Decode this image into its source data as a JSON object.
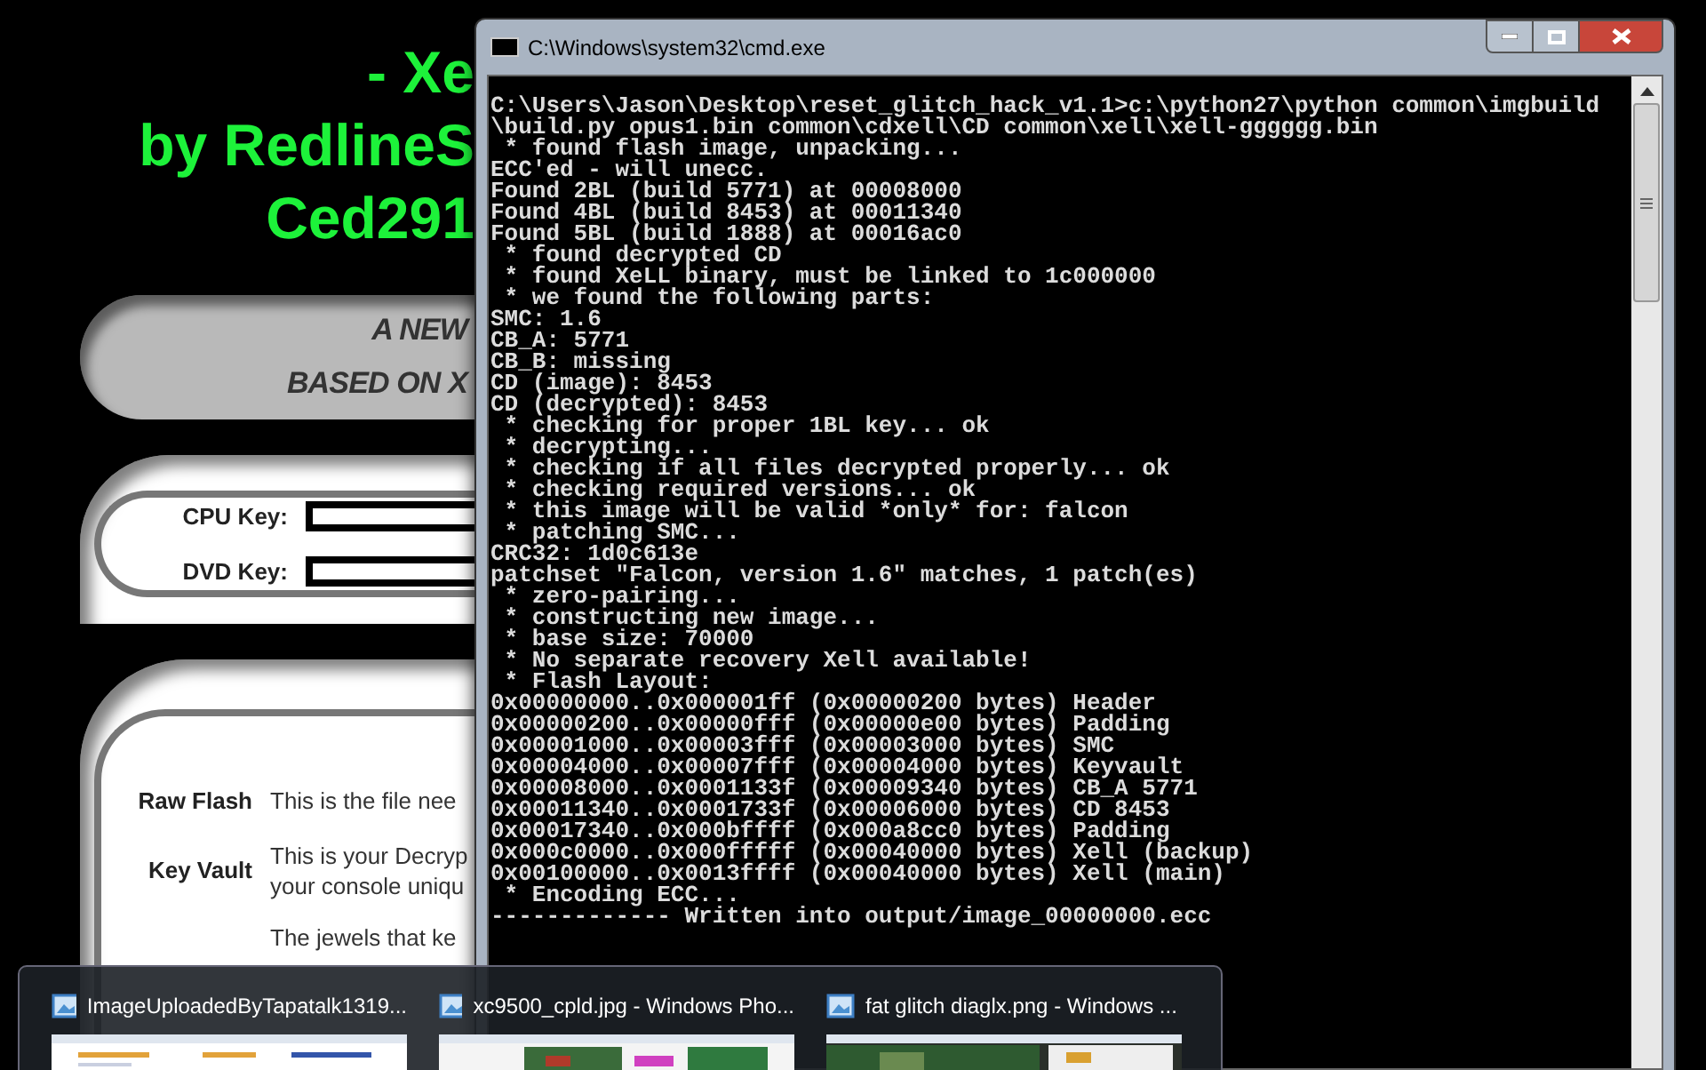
{
  "page": {
    "title_lines": [
      "- Xe",
      "by RedlineS",
      "Ced291"
    ],
    "banner_lines": [
      "A NEW",
      "BASED ON X"
    ],
    "key_fields": [
      {
        "label": "CPU Key:"
      },
      {
        "label": "DVD Key:"
      }
    ],
    "files": [
      {
        "name": "Raw Flash",
        "description": [
          "This is the file nee"
        ]
      },
      {
        "name": "Key Vault",
        "description": [
          "This is your Decryp",
          "your console uniqu"
        ]
      },
      {
        "description": [
          "The jewels that ke"
        ]
      }
    ]
  },
  "console_window": {
    "title": "C:\\Windows\\system32\\cmd.exe",
    "lines": [
      "C:\\Users\\Jason\\Desktop\\reset_glitch_hack_v1.1>c:\\python27\\python common\\imgbuild",
      "\\build.py opus1.bin common\\cdxell\\CD common\\xell\\xell-gggggg.bin",
      " * found flash image, unpacking...",
      "ECC'ed - will unecc.",
      "Found 2BL (build 5771) at 00008000",
      "Found 4BL (build 8453) at 00011340",
      "Found 5BL (build 1888) at 00016ac0",
      " * found decrypted CD",
      " * found XeLL binary, must be linked to 1c000000",
      " * we found the following parts:",
      "SMC: 1.6",
      "CB_A: 5771",
      "CB_B: missing",
      "CD (image): 8453",
      "CD (decrypted): 8453",
      " * checking for proper 1BL key... ok",
      " * decrypting...",
      " * checking if all files decrypted properly... ok",
      " * checking required versions... ok",
      " * this image will be valid *only* for: falcon",
      " * patching SMC...",
      "CRC32: 1d0c613e",
      "patchset \"Falcon, version 1.6\" matches, 1 patch(es)",
      " * zero-pairing...",
      " * constructing new image...",
      " * base size: 70000",
      " * No separate recovery Xell available!",
      " * Flash Layout:",
      "0x00000000..0x000001ff (0x00000200 bytes) Header",
      "0x00000200..0x00000fff (0x00000e00 bytes) Padding",
      "0x00001000..0x00003fff (0x00003000 bytes) SMC",
      "0x00004000..0x00007fff (0x00004000 bytes) Keyvault",
      "0x00008000..0x0001133f (0x00009340 bytes) CB_A 5771",
      "0x00011340..0x0001733f (0x00006000 bytes) CD 8453",
      "0x00017340..0x000bffff (0x000a8cc0 bytes) Padding",
      "0x000c0000..0x000fffff (0x00040000 bytes) Xell (backup)",
      "0x00100000..0x0013ffff (0x00040000 bytes) Xell (main)",
      " * Encoding ECC...",
      "------------- Written into output/image_00000000.ecc"
    ]
  },
  "taskbar_previews": [
    {
      "title": "ImageUploadedByTapatalk1319..."
    },
    {
      "title": "xc9500_cpld.jpg - Windows Pho..."
    },
    {
      "title": "fat glitch diaglx.png - Windows ..."
    }
  ]
}
